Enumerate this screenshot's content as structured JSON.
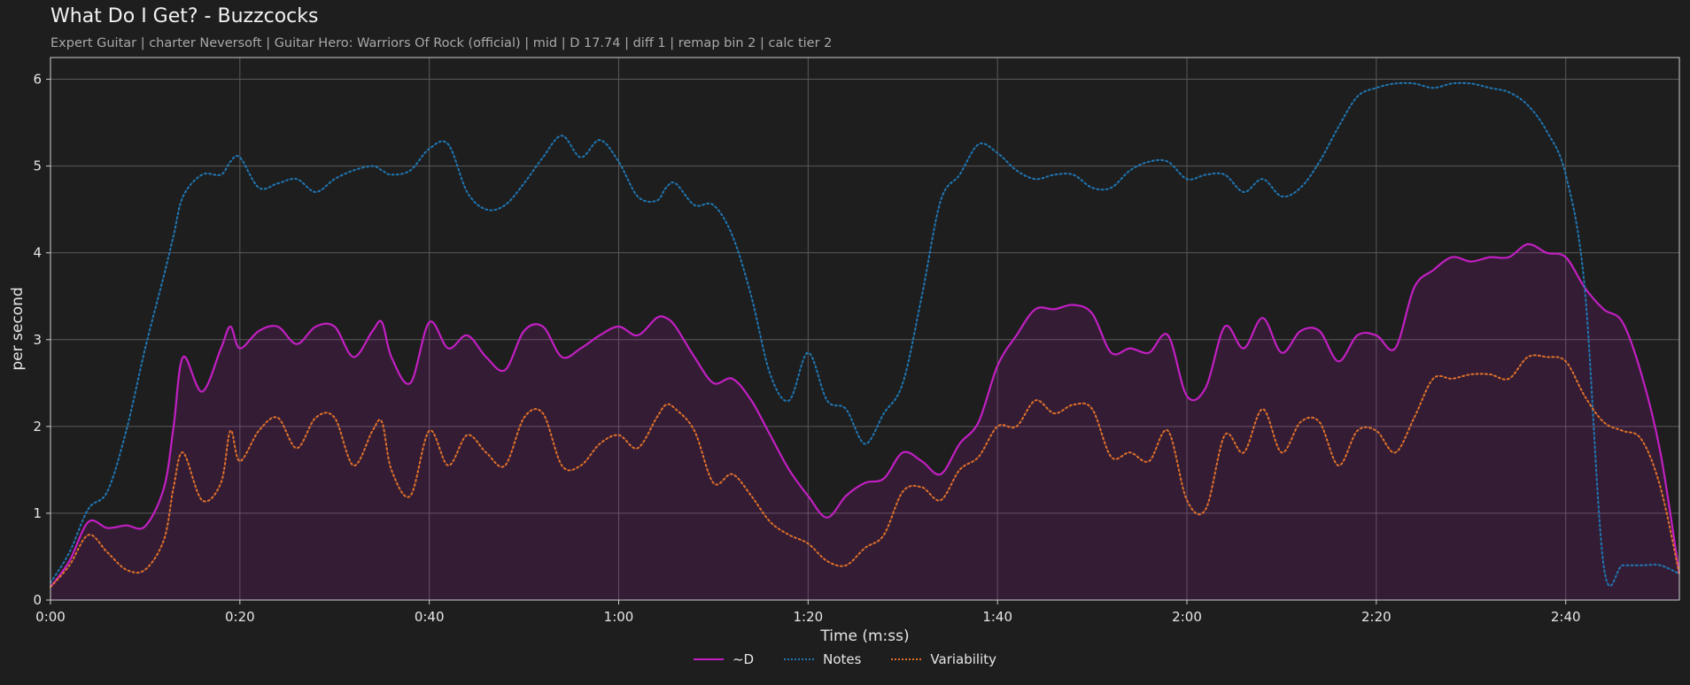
{
  "title": "What Do I Get? - Buzzcocks",
  "subtitle": "Expert Guitar  |  charter Neversoft  |  Guitar Hero: Warriors Of Rock (official)  |  mid  |  D 17.74  |  diff 1  |  remap bin 2  |  calc tier 2",
  "chart_data": {
    "type": "line",
    "title": "What Do I Get? - Buzzcocks",
    "xlabel": "Time (m:ss)",
    "ylabel": "per second",
    "xlim": [
      0,
      172
    ],
    "ylim": [
      0,
      6.25
    ],
    "x_ticks": [
      0,
      20,
      40,
      60,
      80,
      100,
      120,
      140,
      160
    ],
    "x_tick_labels": [
      "0:00",
      "0:20",
      "0:40",
      "1:00",
      "1:20",
      "1:40",
      "2:00",
      "2:20",
      "2:40"
    ],
    "y_ticks": [
      0,
      1,
      2,
      3,
      4,
      5,
      6
    ],
    "y_tick_labels": [
      "0",
      "1",
      "2",
      "3",
      "4",
      "5",
      "6"
    ],
    "grid": true,
    "legend_position": "bottom-center",
    "x": [
      0,
      2,
      4,
      6,
      8,
      10,
      12,
      13,
      14,
      16,
      18,
      19,
      20,
      22,
      24,
      26,
      28,
      30,
      32,
      34,
      35,
      36,
      38,
      40,
      42,
      44,
      46,
      48,
      50,
      52,
      54,
      56,
      58,
      60,
      62,
      64,
      65,
      66,
      68,
      70,
      72,
      74,
      76,
      78,
      80,
      82,
      84,
      86,
      88,
      90,
      92,
      94,
      96,
      98,
      100,
      102,
      104,
      106,
      108,
      110,
      112,
      114,
      116,
      118,
      120,
      122,
      124,
      126,
      128,
      130,
      132,
      134,
      136,
      138,
      140,
      142,
      144,
      146,
      148,
      150,
      152,
      154,
      156,
      158,
      160,
      162,
      164,
      166,
      168,
      170,
      172
    ],
    "series": [
      {
        "name": "~D",
        "style": "solid",
        "color": "#c21fc2",
        "fill": true,
        "values": [
          0.15,
          0.45,
          0.9,
          0.83,
          0.86,
          0.85,
          1.3,
          2.0,
          2.8,
          2.4,
          2.9,
          3.15,
          2.9,
          3.1,
          3.15,
          2.95,
          3.15,
          3.15,
          2.8,
          3.1,
          3.2,
          2.8,
          2.5,
          3.2,
          2.9,
          3.05,
          2.8,
          2.65,
          3.1,
          3.15,
          2.8,
          2.9,
          3.05,
          3.15,
          3.05,
          3.25,
          3.25,
          3.15,
          2.8,
          2.5,
          2.55,
          2.3,
          1.9,
          1.5,
          1.2,
          0.95,
          1.2,
          1.35,
          1.4,
          1.7,
          1.6,
          1.45,
          1.8,
          2.05,
          2.7,
          3.05,
          3.35,
          3.35,
          3.4,
          3.3,
          2.85,
          2.9,
          2.85,
          3.05,
          2.35,
          2.45,
          3.15,
          2.9,
          3.25,
          2.85,
          3.1,
          3.1,
          2.75,
          3.05,
          3.05,
          2.9,
          3.6,
          3.8,
          3.95,
          3.9,
          3.95,
          3.95,
          4.1,
          4.0,
          3.95,
          3.6,
          3.35,
          3.2,
          2.6,
          1.7,
          0.3
        ]
      },
      {
        "name": "Notes",
        "style": "dotted",
        "color": "#1f77b4",
        "fill": false,
        "values": [
          0.2,
          0.55,
          1.05,
          1.25,
          1.95,
          2.9,
          3.75,
          4.2,
          4.65,
          4.9,
          4.9,
          5.05,
          5.1,
          4.75,
          4.8,
          4.85,
          4.7,
          4.85,
          4.95,
          5.0,
          4.95,
          4.9,
          4.95,
          5.2,
          5.25,
          4.7,
          4.5,
          4.55,
          4.8,
          5.1,
          5.35,
          5.1,
          5.3,
          5.05,
          4.65,
          4.6,
          4.75,
          4.8,
          4.55,
          4.55,
          4.2,
          3.5,
          2.6,
          2.3,
          2.85,
          2.3,
          2.2,
          1.8,
          2.15,
          2.5,
          3.5,
          4.6,
          4.9,
          5.25,
          5.15,
          4.95,
          4.85,
          4.9,
          4.9,
          4.75,
          4.75,
          4.95,
          5.05,
          5.05,
          4.85,
          4.9,
          4.9,
          4.7,
          4.85,
          4.65,
          4.75,
          5.05,
          5.45,
          5.8,
          5.9,
          5.95,
          5.95,
          5.9,
          5.95,
          5.95,
          5.9,
          5.85,
          5.7,
          5.4,
          4.9,
          3.6,
          0.4,
          0.4,
          0.4,
          0.4,
          0.3
        ]
      },
      {
        "name": "Variability",
        "style": "dotted",
        "color": "#e0702a",
        "fill": false,
        "values": [
          0.15,
          0.4,
          0.75,
          0.55,
          0.35,
          0.35,
          0.7,
          1.3,
          1.7,
          1.15,
          1.35,
          1.95,
          1.6,
          1.95,
          2.1,
          1.75,
          2.1,
          2.1,
          1.55,
          1.95,
          2.05,
          1.5,
          1.2,
          1.95,
          1.55,
          1.9,
          1.7,
          1.55,
          2.1,
          2.15,
          1.55,
          1.55,
          1.8,
          1.9,
          1.75,
          2.1,
          2.25,
          2.2,
          1.95,
          1.35,
          1.45,
          1.2,
          0.9,
          0.75,
          0.65,
          0.45,
          0.4,
          0.6,
          0.75,
          1.25,
          1.3,
          1.15,
          1.5,
          1.65,
          2.0,
          2.0,
          2.3,
          2.15,
          2.25,
          2.2,
          1.65,
          1.7,
          1.6,
          1.95,
          1.15,
          1.05,
          1.9,
          1.7,
          2.2,
          1.7,
          2.05,
          2.05,
          1.55,
          1.95,
          1.95,
          1.7,
          2.1,
          2.55,
          2.55,
          2.6,
          2.6,
          2.55,
          2.8,
          2.8,
          2.75,
          2.35,
          2.05,
          1.95,
          1.85,
          1.3,
          0.3
        ]
      }
    ]
  }
}
